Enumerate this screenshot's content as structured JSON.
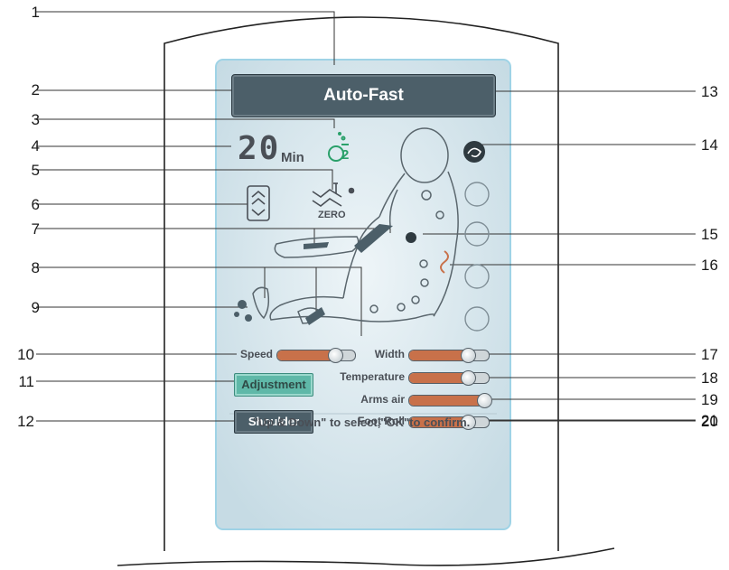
{
  "display": {
    "program_title": "Auto-Fast",
    "timer_value": "20",
    "timer_unit": "Min",
    "oxygen_label": "2",
    "zero_label": "ZERO",
    "buttons": {
      "adjustment": "Adjustment",
      "shoulder": "Shoulder"
    },
    "footer_hint": "\"Up & Down\" to select,\"OK\"to confirm."
  },
  "sliders": [
    {
      "label": "Speed",
      "level": 0.75
    },
    {
      "label": "Width",
      "level": 0.75
    },
    {
      "label": "Temperature",
      "level": 0.75
    },
    {
      "label": "Arms air",
      "level": 0.95
    },
    {
      "label": "Foot Roll",
      "level": 0.75
    }
  ],
  "callouts": [
    "1",
    "2",
    "3",
    "4",
    "5",
    "6",
    "7",
    "8",
    "9",
    "10",
    "11",
    "12",
    "13",
    "14",
    "15",
    "16",
    "17",
    "18",
    "19",
    "20",
    "21"
  ],
  "colors": {
    "screen_bg": "#d3e3ea",
    "screen_border": "#9fd3e6",
    "title_bar": "#4c5f69",
    "slider_fill": "#c8714a",
    "adjust_button": "#5fb8a8",
    "oxygen_icon": "#2aa06a",
    "heat_icon": "#c8714a"
  },
  "icons": [
    "bluetooth-icon",
    "oxygen-icon",
    "zero-gravity-icon",
    "backrest-recline-icon",
    "hand-massage-icon",
    "foot-roller-icon",
    "heat-icon"
  ]
}
